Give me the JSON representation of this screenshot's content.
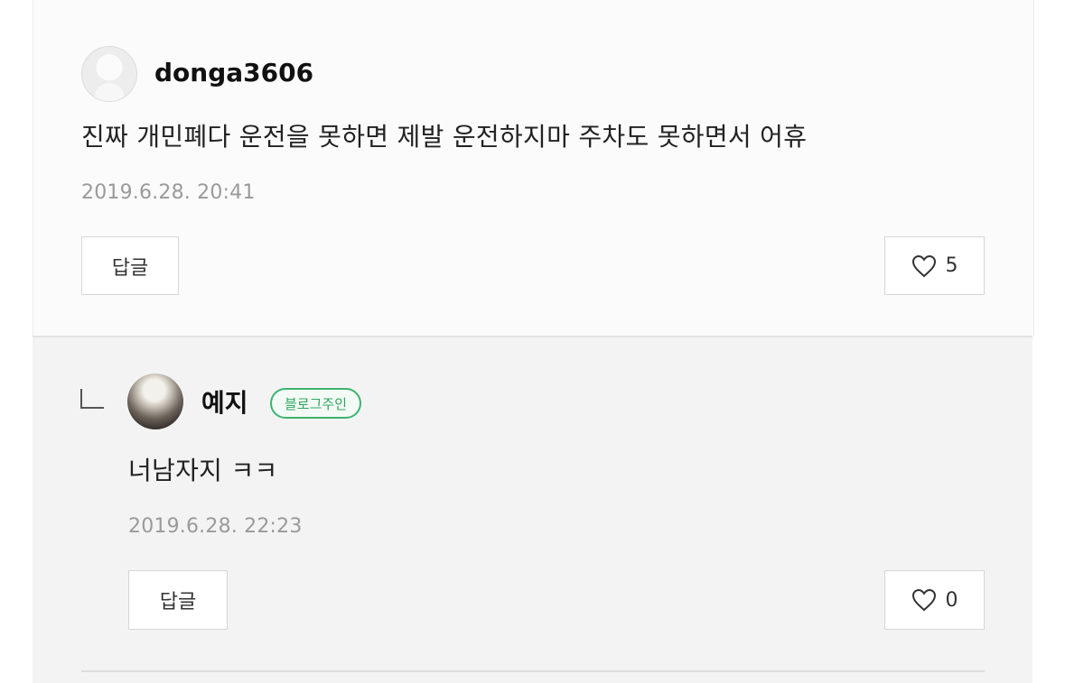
{
  "comments": [
    {
      "author": "donga3606",
      "text": "진짜 개민폐다 운전을 못하면 제발 운전하지마 주차도 못하면서 어휴",
      "date": "2019.6.28. 20:41",
      "reply_label": "답글",
      "like_count": "5"
    }
  ],
  "reply": {
    "author": "예지",
    "badge": "블로그주인",
    "text": "너남자지 ㅋㅋ",
    "date": "2019.6.28. 22:23",
    "reply_label": "답글",
    "like_count": "0"
  }
}
